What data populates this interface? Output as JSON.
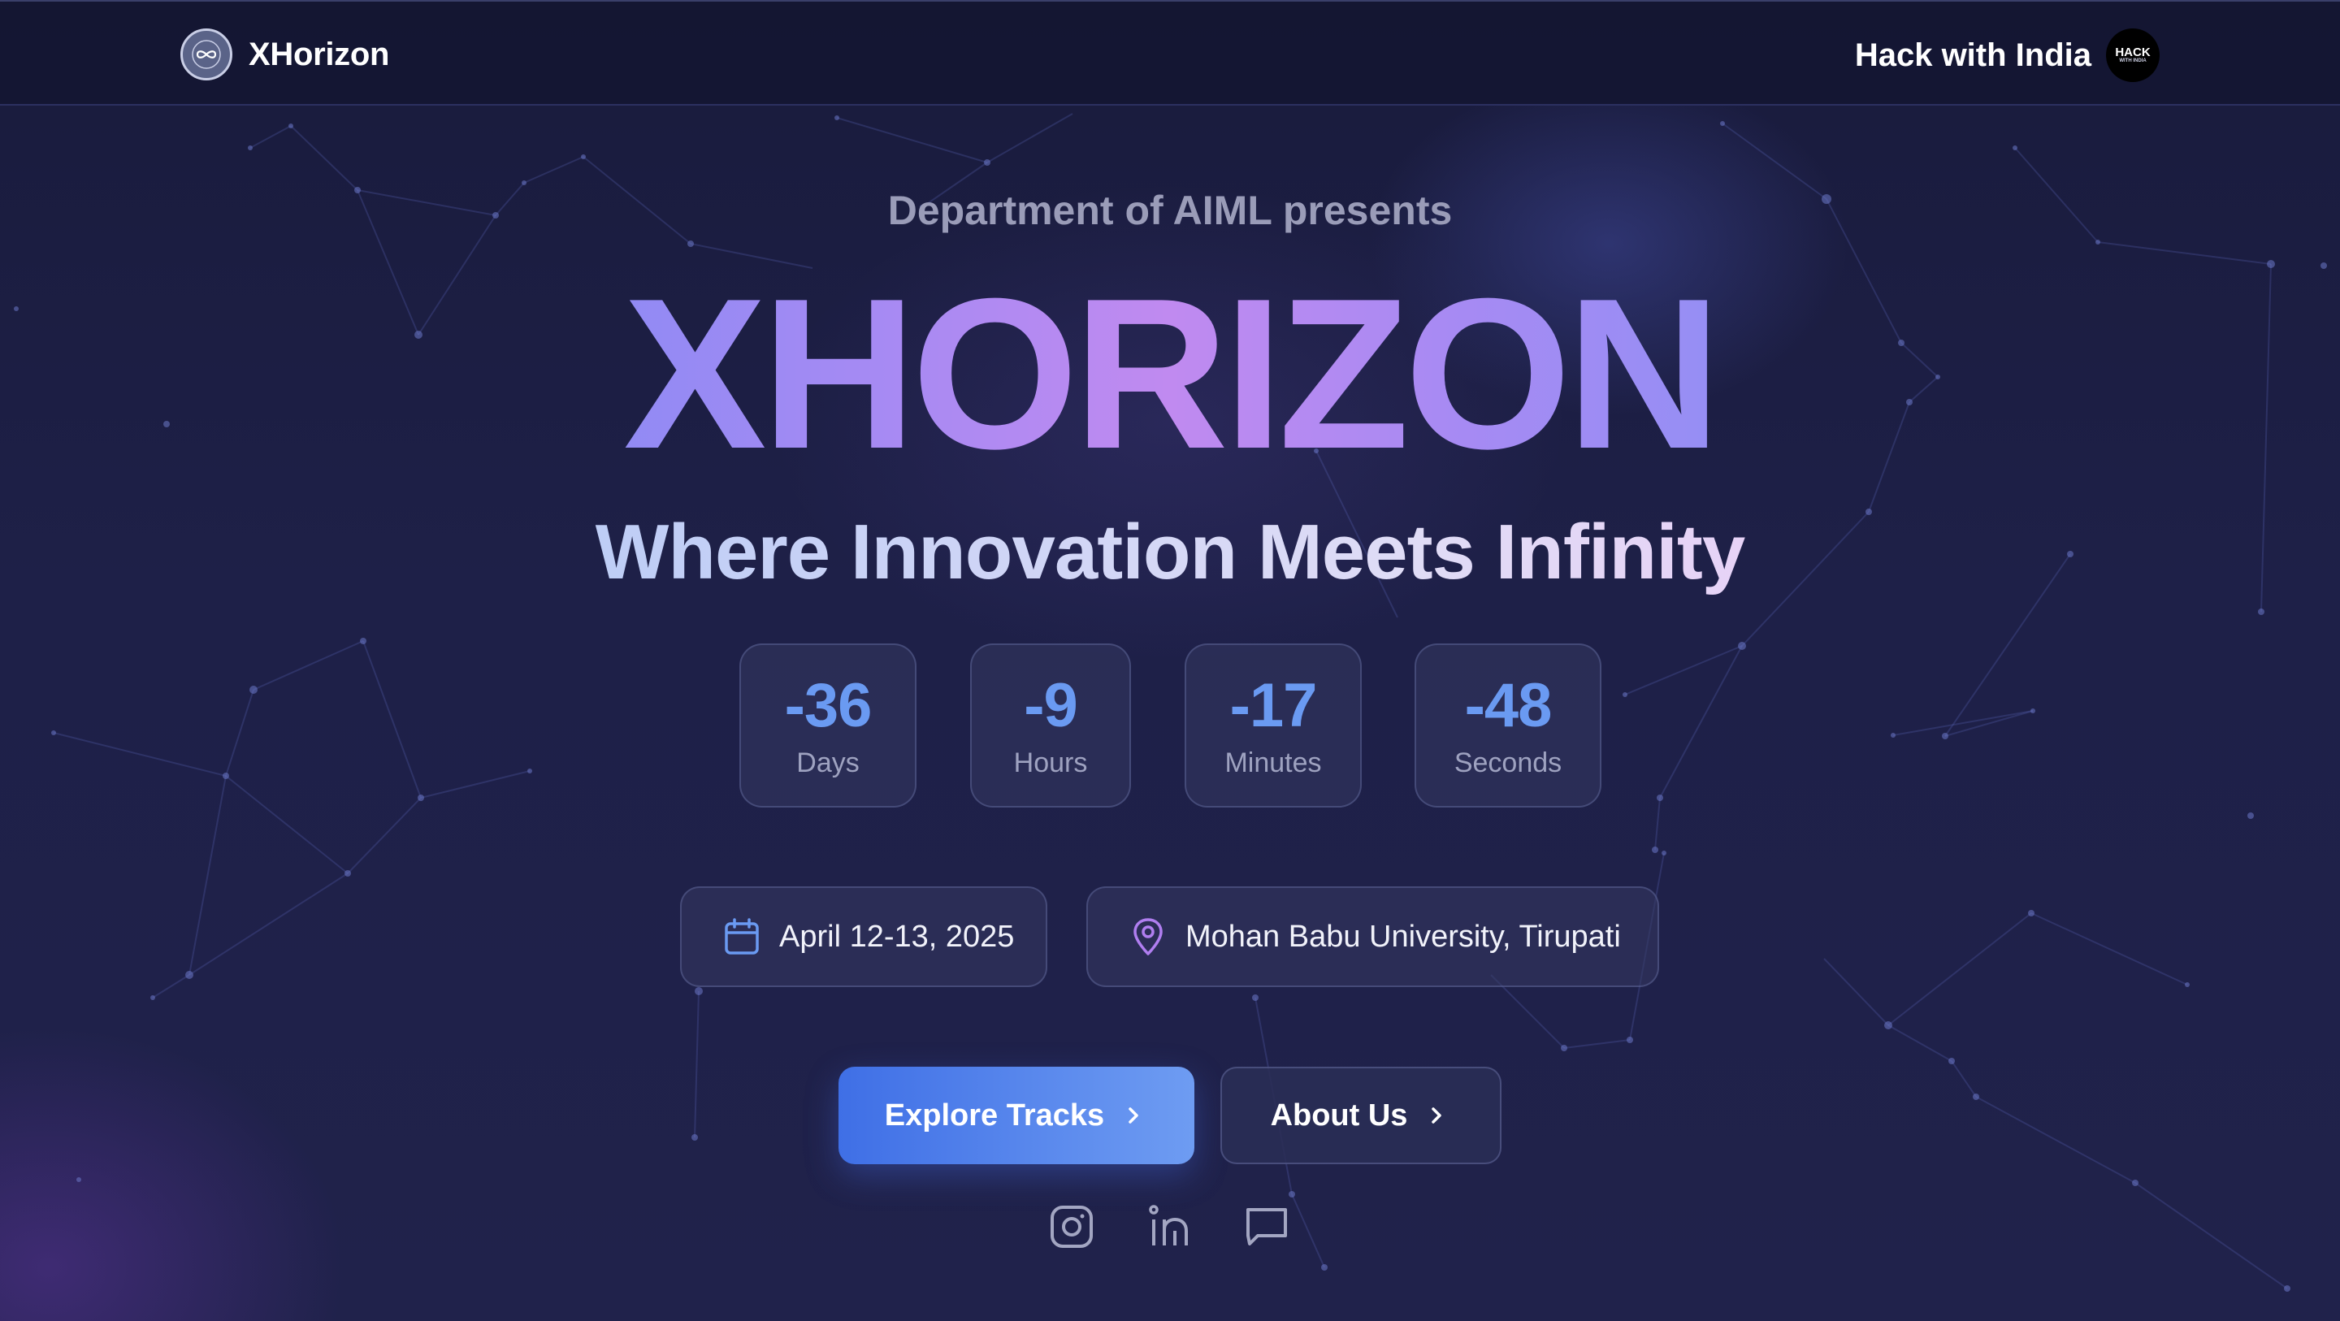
{
  "navbar": {
    "brand_name": "XHorizon",
    "partner_name": "Hack with India",
    "partner_badge_line1": "HACK",
    "partner_badge_line2": "WITH INDIA"
  },
  "hero": {
    "presenter": "Department of AIML presents",
    "title": "XHORIZON",
    "tagline": "Where Innovation Meets Infinity"
  },
  "countdown": [
    {
      "value": "-36",
      "unit": "Days"
    },
    {
      "value": "-9",
      "unit": "Hours"
    },
    {
      "value": "-17",
      "unit": "Minutes"
    },
    {
      "value": "-48",
      "unit": "Seconds"
    }
  ],
  "event": {
    "date": "April 12-13, 2025",
    "venue": "Mohan Babu University, Tirupati"
  },
  "actions": {
    "primary_label": "Explore Tracks",
    "secondary_label": "About Us"
  },
  "socials": [
    "instagram-icon",
    "linkedin-icon",
    "chat-icon"
  ],
  "colors": {
    "background": "#1e1f45",
    "accent_blue": "#6a9af2",
    "accent_purple": "#c08af0",
    "primary_button_start": "#3f6fe6",
    "primary_button_end": "#6e9cf2"
  }
}
